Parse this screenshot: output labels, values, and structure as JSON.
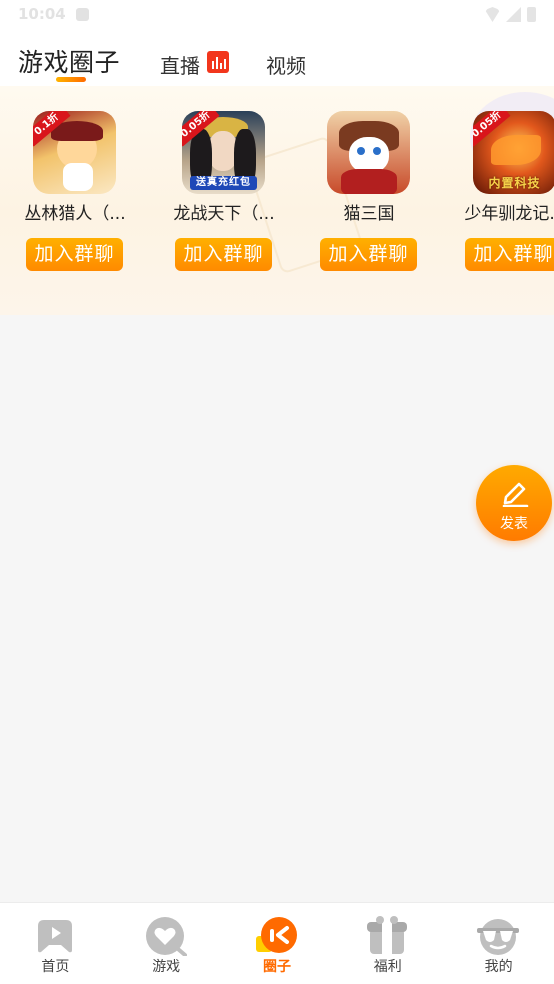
{
  "status_bar": {
    "time": "10:04"
  },
  "header": {
    "tabs": [
      {
        "label": "游戏圈子",
        "active": true
      },
      {
        "label": "直播",
        "active": false
      },
      {
        "label": "视频",
        "active": false
      }
    ]
  },
  "games": [
    {
      "name": "丛林猎人（...",
      "badge": "0.1折",
      "join_label": "加入群聊"
    },
    {
      "name": "龙战天下（...",
      "badge": "0.05折",
      "banner": "送真充红包",
      "join_label": "加入群聊"
    },
    {
      "name": "猫三国",
      "join_label": "加入群聊"
    },
    {
      "name": "少年驯龙记...",
      "badge": "0.05折",
      "banner": "内置科技",
      "join_label": "加入群聊"
    }
  ],
  "fab": {
    "label": "发表",
    "icon": "pen-icon"
  },
  "bottom_nav": {
    "items": [
      {
        "label": "首页",
        "icon": "gamepad-icon",
        "active": false
      },
      {
        "label": "游戏",
        "icon": "heart-search-icon",
        "active": false
      },
      {
        "label": "圈子",
        "icon": "circle-icon",
        "active": true
      },
      {
        "label": "福利",
        "icon": "gift-icon",
        "active": false
      },
      {
        "label": "我的",
        "icon": "sunglasses-icon",
        "active": false
      }
    ]
  },
  "colors": {
    "accent": "#ff8a00",
    "live": "#f2361c",
    "active_nav": "#ff6a00"
  }
}
